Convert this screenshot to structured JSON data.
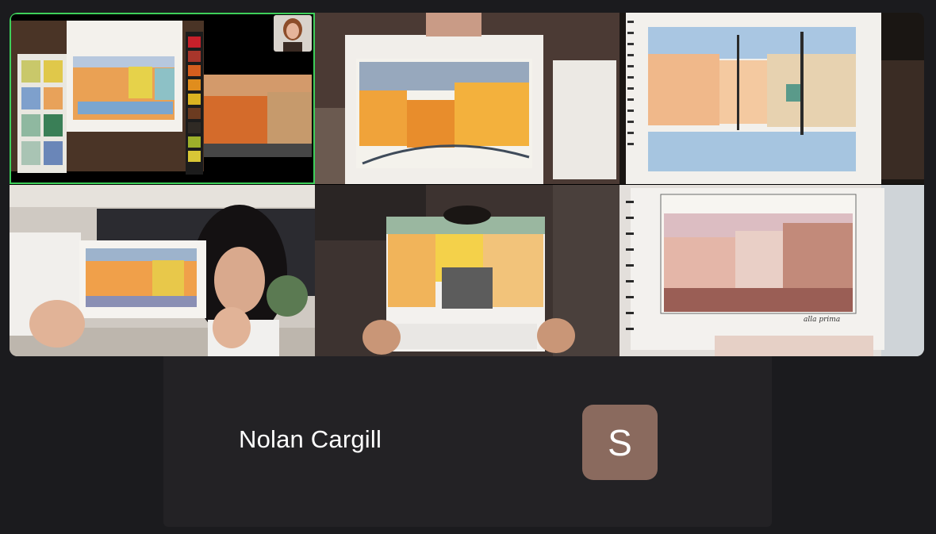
{
  "app": {
    "name": "Video call gallery view"
  },
  "colors": {
    "active_speaker_border": "#3ecf5a",
    "background": "#1b1b1e",
    "avatar_bg": "#8a6a5e"
  },
  "tiles": [
    {
      "id": "tile-1",
      "content": "watercolor palette and city sketch with reference photo",
      "active_speaker": true
    },
    {
      "id": "tile-2",
      "content": "spiral sketchbook with orange city watercolor",
      "active_speaker": false
    },
    {
      "id": "tile-3",
      "content": "pastel watercolor street scene in spiral sketchbook",
      "active_speaker": false
    },
    {
      "id": "tile-4",
      "content": "participant holding small landscape sketchbook",
      "active_speaker": false
    },
    {
      "id": "tile-5",
      "content": "participant holding yellow building watercolor",
      "active_speaker": false
    },
    {
      "id": "tile-6",
      "content": "pink pastel city watercolor",
      "active_speaker": false
    }
  ],
  "painting_caption": "alla prima",
  "audio_only_participant": {
    "name": "Nolan Cargill",
    "avatar_initial": "S"
  }
}
